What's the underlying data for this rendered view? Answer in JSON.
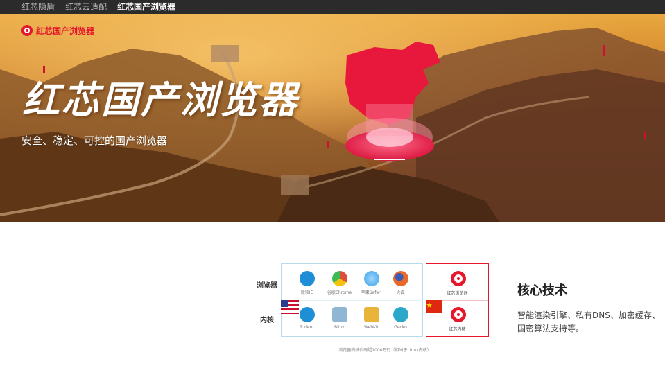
{
  "nav": {
    "items": [
      {
        "label": "红芯隐盾",
        "active": false
      },
      {
        "label": "红芯云适配",
        "active": false
      },
      {
        "label": "红芯国产浏览器",
        "active": true
      }
    ]
  },
  "hero": {
    "brand": "红芯国产浏览器",
    "title": "红芯国产浏览器",
    "subtitle": "安全、稳定、可控的国产浏览器"
  },
  "comparison": {
    "row_labels": {
      "browsers": "浏览器",
      "kernels": "内核"
    },
    "browsers": [
      {
        "name": "微软IE",
        "icon": "ie-icon",
        "color": "#1e8fd6"
      },
      {
        "name": "谷歌Chrome",
        "icon": "chrome-icon",
        "color": "#dd4b39"
      },
      {
        "name": "苹果Safari",
        "icon": "safari-icon",
        "color": "#3aa0e6"
      },
      {
        "name": "火狐",
        "icon": "firefox-icon",
        "color": "#e8692a"
      }
    ],
    "kernels": [
      {
        "name": "Trident",
        "icon": "trident-icon",
        "color": "#1e8fd6"
      },
      {
        "name": "Blink",
        "icon": "blink-icon",
        "color": "#8fb7d3"
      },
      {
        "name": "WebKit",
        "icon": "webkit-icon",
        "color": "#e9b43a"
      },
      {
        "name": "Gecko",
        "icon": "gecko-icon",
        "color": "#2aa7c9"
      }
    ],
    "redcore_browser": "红芯浏览器",
    "redcore_kernel": "红芯内核",
    "note": "浏览器内核代码超1000万行（相当于Linux内核）"
  },
  "core": {
    "title": "核心技术",
    "description": "智能渲染引擎、私有DNS、加密缓存、国密算法支持等。"
  },
  "colors": {
    "accent": "#e5172b",
    "nav_bg": "#2b2b2b"
  }
}
